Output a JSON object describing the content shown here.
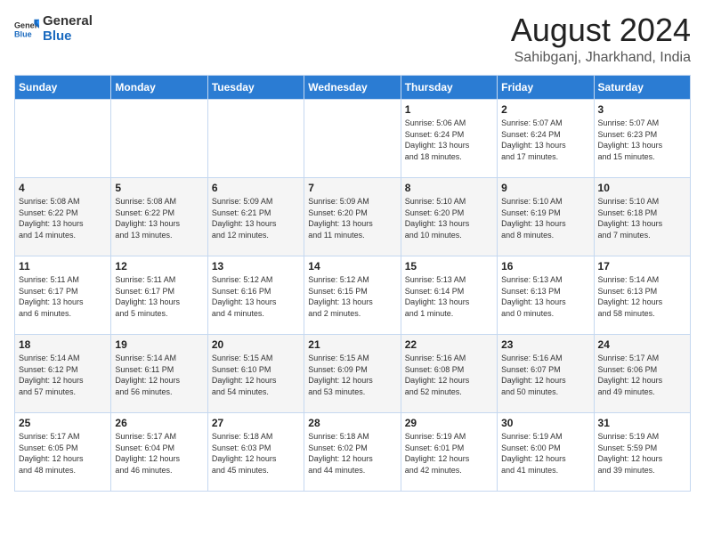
{
  "header": {
    "logo_general": "General",
    "logo_blue": "Blue",
    "month_year": "August 2024",
    "location": "Sahibganj, Jharkhand, India"
  },
  "weekdays": [
    "Sunday",
    "Monday",
    "Tuesday",
    "Wednesday",
    "Thursday",
    "Friday",
    "Saturday"
  ],
  "weeks": [
    [
      {
        "day": "",
        "info": ""
      },
      {
        "day": "",
        "info": ""
      },
      {
        "day": "",
        "info": ""
      },
      {
        "day": "",
        "info": ""
      },
      {
        "day": "1",
        "info": "Sunrise: 5:06 AM\nSunset: 6:24 PM\nDaylight: 13 hours\nand 18 minutes."
      },
      {
        "day": "2",
        "info": "Sunrise: 5:07 AM\nSunset: 6:24 PM\nDaylight: 13 hours\nand 17 minutes."
      },
      {
        "day": "3",
        "info": "Sunrise: 5:07 AM\nSunset: 6:23 PM\nDaylight: 13 hours\nand 15 minutes."
      }
    ],
    [
      {
        "day": "4",
        "info": "Sunrise: 5:08 AM\nSunset: 6:22 PM\nDaylight: 13 hours\nand 14 minutes."
      },
      {
        "day": "5",
        "info": "Sunrise: 5:08 AM\nSunset: 6:22 PM\nDaylight: 13 hours\nand 13 minutes."
      },
      {
        "day": "6",
        "info": "Sunrise: 5:09 AM\nSunset: 6:21 PM\nDaylight: 13 hours\nand 12 minutes."
      },
      {
        "day": "7",
        "info": "Sunrise: 5:09 AM\nSunset: 6:20 PM\nDaylight: 13 hours\nand 11 minutes."
      },
      {
        "day": "8",
        "info": "Sunrise: 5:10 AM\nSunset: 6:20 PM\nDaylight: 13 hours\nand 10 minutes."
      },
      {
        "day": "9",
        "info": "Sunrise: 5:10 AM\nSunset: 6:19 PM\nDaylight: 13 hours\nand 8 minutes."
      },
      {
        "day": "10",
        "info": "Sunrise: 5:10 AM\nSunset: 6:18 PM\nDaylight: 13 hours\nand 7 minutes."
      }
    ],
    [
      {
        "day": "11",
        "info": "Sunrise: 5:11 AM\nSunset: 6:17 PM\nDaylight: 13 hours\nand 6 minutes."
      },
      {
        "day": "12",
        "info": "Sunrise: 5:11 AM\nSunset: 6:17 PM\nDaylight: 13 hours\nand 5 minutes."
      },
      {
        "day": "13",
        "info": "Sunrise: 5:12 AM\nSunset: 6:16 PM\nDaylight: 13 hours\nand 4 minutes."
      },
      {
        "day": "14",
        "info": "Sunrise: 5:12 AM\nSunset: 6:15 PM\nDaylight: 13 hours\nand 2 minutes."
      },
      {
        "day": "15",
        "info": "Sunrise: 5:13 AM\nSunset: 6:14 PM\nDaylight: 13 hours\nand 1 minute."
      },
      {
        "day": "16",
        "info": "Sunrise: 5:13 AM\nSunset: 6:13 PM\nDaylight: 13 hours\nand 0 minutes."
      },
      {
        "day": "17",
        "info": "Sunrise: 5:14 AM\nSunset: 6:13 PM\nDaylight: 12 hours\nand 58 minutes."
      }
    ],
    [
      {
        "day": "18",
        "info": "Sunrise: 5:14 AM\nSunset: 6:12 PM\nDaylight: 12 hours\nand 57 minutes."
      },
      {
        "day": "19",
        "info": "Sunrise: 5:14 AM\nSunset: 6:11 PM\nDaylight: 12 hours\nand 56 minutes."
      },
      {
        "day": "20",
        "info": "Sunrise: 5:15 AM\nSunset: 6:10 PM\nDaylight: 12 hours\nand 54 minutes."
      },
      {
        "day": "21",
        "info": "Sunrise: 5:15 AM\nSunset: 6:09 PM\nDaylight: 12 hours\nand 53 minutes."
      },
      {
        "day": "22",
        "info": "Sunrise: 5:16 AM\nSunset: 6:08 PM\nDaylight: 12 hours\nand 52 minutes."
      },
      {
        "day": "23",
        "info": "Sunrise: 5:16 AM\nSunset: 6:07 PM\nDaylight: 12 hours\nand 50 minutes."
      },
      {
        "day": "24",
        "info": "Sunrise: 5:17 AM\nSunset: 6:06 PM\nDaylight: 12 hours\nand 49 minutes."
      }
    ],
    [
      {
        "day": "25",
        "info": "Sunrise: 5:17 AM\nSunset: 6:05 PM\nDaylight: 12 hours\nand 48 minutes."
      },
      {
        "day": "26",
        "info": "Sunrise: 5:17 AM\nSunset: 6:04 PM\nDaylight: 12 hours\nand 46 minutes."
      },
      {
        "day": "27",
        "info": "Sunrise: 5:18 AM\nSunset: 6:03 PM\nDaylight: 12 hours\nand 45 minutes."
      },
      {
        "day": "28",
        "info": "Sunrise: 5:18 AM\nSunset: 6:02 PM\nDaylight: 12 hours\nand 44 minutes."
      },
      {
        "day": "29",
        "info": "Sunrise: 5:19 AM\nSunset: 6:01 PM\nDaylight: 12 hours\nand 42 minutes."
      },
      {
        "day": "30",
        "info": "Sunrise: 5:19 AM\nSunset: 6:00 PM\nDaylight: 12 hours\nand 41 minutes."
      },
      {
        "day": "31",
        "info": "Sunrise: 5:19 AM\nSunset: 5:59 PM\nDaylight: 12 hours\nand 39 minutes."
      }
    ]
  ]
}
